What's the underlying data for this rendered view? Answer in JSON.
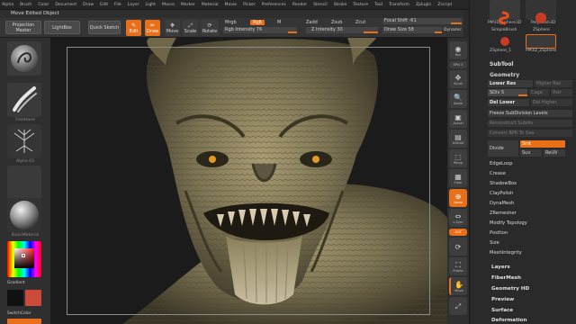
{
  "menu": [
    "Alpha",
    "Brush",
    "Color",
    "Document",
    "Draw",
    "Edit",
    "File",
    "Layer",
    "Light",
    "Macro",
    "Marker",
    "Material",
    "Movie",
    "Picker",
    "Preferences",
    "Render",
    "Stencil",
    "Stroke",
    "Texture",
    "Tool",
    "Transform",
    "Zplugin",
    "Zscript"
  ],
  "status": "Move Edited Object",
  "toolbar": {
    "projection_master": "Projection Master",
    "lightbox": "LightBox",
    "quick_sketch": "Quick Sketch",
    "edit": "Edit",
    "draw": "Draw",
    "move": "Move",
    "scale": "Scale",
    "rotate": "Rotate",
    "mrgb": "Mrgb",
    "rgb": "Rgb",
    "m": "M",
    "zadd": "Zadd",
    "zsub": "Zsub",
    "zcut": "Zcut",
    "rgb_intensity": "Rgb Intensity 76",
    "z_intensity": "Z Intensity 30",
    "focal_shift": "Focal Shift -61",
    "draw_size": "Draw Size 58",
    "dynamic": "Dynamic"
  },
  "left": {
    "tile_labels": [
      "",
      "FreeHand",
      "Alpha 03",
      "Texture Off",
      "BasicMaterial"
    ],
    "gradient": "Gradient",
    "switch_color": "SwitchColor",
    "colors": {
      "primary": "#cc3333",
      "secondary": "#111111",
      "accent": "#e8701a"
    }
  },
  "shelf": [
    "Bpr",
    "SPix 3",
    "Scroll",
    "Zoom",
    "Actual",
    "AAHalf",
    "Persp",
    "Floor",
    "Local",
    "L.Sym",
    "XYZ",
    "",
    "Frame",
    "Move",
    ""
  ],
  "tray": {
    "tools": [
      "PM3D_Sphere3D",
      "PolyMesh3D",
      "SimpleBrush",
      "ZSphere",
      "ZSphere_1",
      "PM3D_ZSphere"
    ],
    "subtool": "SubTool",
    "geometry": "Geometry",
    "lower_res": "Lower Res",
    "higher_res": "Higher Res",
    "sdiv": "SDiv 5",
    "cage": "Cage",
    "rstr": "Rstr",
    "del_lower": "Del Lower",
    "del_higher": "Del Higher",
    "freeze": "Freeze SubDivision Levels",
    "reconstruct": "Reconstruct Subdiv",
    "convert": "Convert BPR To Geo",
    "divide": "Divide",
    "smt": "Smt",
    "suv": "Suv",
    "reuv": "ReUV",
    "items": [
      "EdgeLoop",
      "Crease",
      "ShadowBox",
      "ClayPolish",
      "DynaMesh",
      "ZRemesher",
      "Modify Topology",
      "Position",
      "Size",
      "MeshIntegrity"
    ],
    "panels": [
      "Layers",
      "FiberMesh",
      "Geometry HD",
      "Preview",
      "Surface",
      "Deformation"
    ]
  }
}
